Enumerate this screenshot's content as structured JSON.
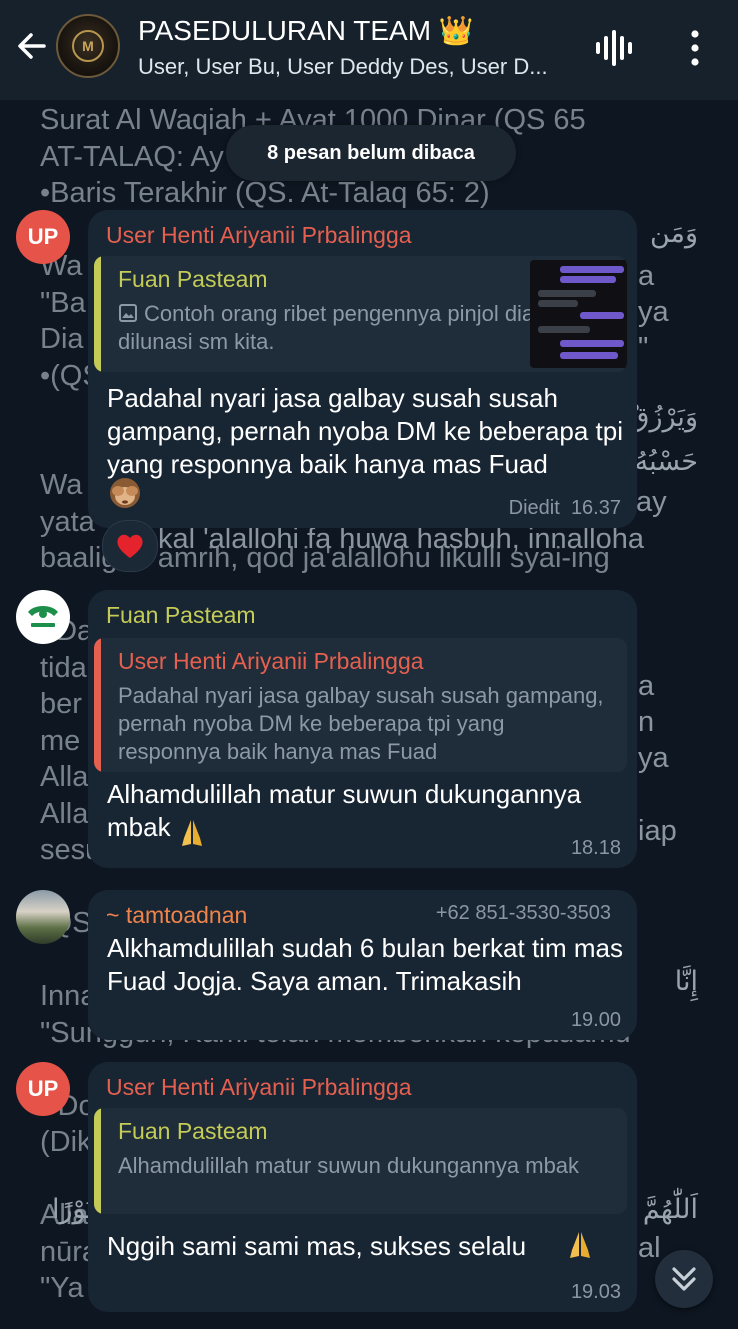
{
  "header": {
    "title": "PASEDULURAN TEAM 👑",
    "subtitle": "User, User Bu, User Deddy Des, User D...",
    "avatar_letter": "M"
  },
  "background_text": {
    "lines": [
      "Surat Al Waqiah + Ayat 1000 Dinar (QS 65",
      "AT-TALAQ: Ay",
      "•Baris Terakhir (QS. At-Talaq 65: 2)",
      "",
      "Wa",
      "\"Ba",
      "Dia",
      "•(QS",
      "",
      "",
      "Wa",
      "yata",
      "baalighu amrih, qod ja'alallohu likulli syai-ing",
      "",
      "  Da",
      "tida",
      "ber",
      "me",
      "Alla",
      "Alla",
      "sesuatu",
      "",
      "(QS",
      "",
      "Inna",
      "\"Sungguh, Kami telah memberikan kepadamu",
      "",
      "●Do",
      "(Dik",
      "",
      "Alla",
      "nūra",
      "\"Ya Allah tambahkanlah cahaya bagiku"
    ],
    "right_fragments": [
      "a",
      "ya",
      "\"",
      "ay",
      "kal 'alallohi fa huwa hasbuh, innalloha",
      "a",
      "n",
      "ya",
      "iap",
      "al",
      "ا"
    ],
    "arabic": {
      "waman": "وَمَن",
      "wayarzuq": "وَيَرْزُقْ",
      "hasbuh": "حَسْبُهُ",
      "inna": "إِنَّا",
      "allahumma": "اَللّٰهُمَّ",
      "nura": "نُوْرًا"
    }
  },
  "unread_pill": "8 pesan belum dibaca",
  "colors": {
    "user_up_name": "#e5604f",
    "fuan_name": "#c4cc57",
    "tamto_name": "#f0844a",
    "accent_avatar_up": "#e55349"
  },
  "messages": [
    {
      "avatar": "UP",
      "sender": "User Henti Ariyanii Prbalingga",
      "reply_name": "Fuan Pasteam",
      "reply_text": "Contoh orang ribet pengennya pinjol dia dilunasi sm kita.",
      "text": "Padahal nyari jasa galbay susah susah gampang, pernah nyoba DM ke beberapa tpi yang responnya baik hanya mas Fuad",
      "edited": "Diedit",
      "time": "16.37",
      "reaction": "heart"
    },
    {
      "avatar": "PASTEAM",
      "sender": "Fuan Pasteam",
      "reply_name": "User Henti Ariyanii Prbalingga",
      "reply_text": "Padahal nyari jasa galbay susah susah gampang, pernah nyoba DM ke beberapa tpi yang responnya baik hanya mas Fuad",
      "text": "Alhamdulillah matur suwun dukungannya mbak",
      "time": "18.18"
    },
    {
      "sender": "~ tamtoadnan",
      "phone": "+62 851-3530-3503",
      "text": "Alkhamdulillah sudah 6 bulan berkat tim mas Fuad Jogja. Saya aman. Trimakasih",
      "time": "19.00"
    },
    {
      "avatar": "UP",
      "sender": "User Henti Ariyanii Prbalingga",
      "reply_name": "Fuan Pasteam",
      "reply_text": "Alhamdulillah matur suwun dukungannya mbak",
      "text": "Nggih sami sami mas, sukses selalu",
      "time": "19.03"
    }
  ],
  "icons": {
    "back": "arrow-left-icon",
    "voice": "voice-chat-icon",
    "more": "more-vertical-icon",
    "image": "image-icon",
    "scroll": "chevrons-down-icon"
  }
}
